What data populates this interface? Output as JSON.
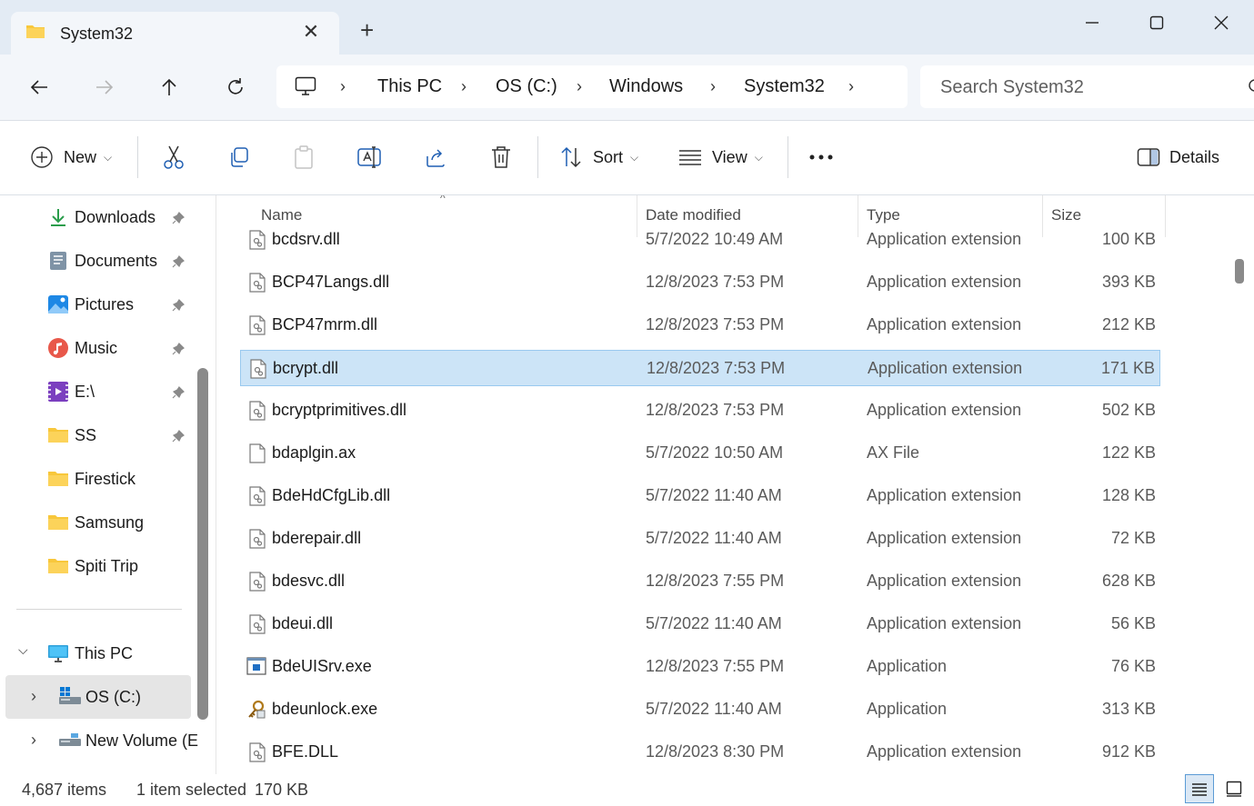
{
  "window": {
    "tab_title": "System32",
    "colors": {
      "accent": "#0067c0",
      "selection": "#cce4f7",
      "folder": "#f8c73b"
    }
  },
  "address": {
    "crumbs": [
      "This PC",
      "OS (C:)",
      "Windows",
      "System32"
    ]
  },
  "search": {
    "placeholder": "Search System32"
  },
  "toolbar": {
    "new_label": "New",
    "sort_label": "Sort",
    "view_label": "View",
    "details_label": "Details"
  },
  "nav": {
    "quick_access": [
      {
        "label": "Downloads",
        "icon": "download-icon",
        "pinned": true
      },
      {
        "label": "Documents",
        "icon": "documents-icon",
        "pinned": true
      },
      {
        "label": "Pictures",
        "icon": "pictures-icon",
        "pinned": true
      },
      {
        "label": "Music",
        "icon": "music-icon",
        "pinned": true
      },
      {
        "label": "E:\\",
        "icon": "video-icon",
        "pinned": true
      },
      {
        "label": "SS",
        "icon": "folder-icon",
        "pinned": true
      },
      {
        "label": "Firestick",
        "icon": "folder-icon",
        "pinned": false
      },
      {
        "label": "Samsung",
        "icon": "folder-icon",
        "pinned": false
      },
      {
        "label": "Spiti Trip",
        "icon": "folder-icon",
        "pinned": false
      }
    ],
    "this_pc": "This PC",
    "drives": [
      {
        "label": "OS (C:)",
        "selected": true
      },
      {
        "label": "New Volume (E",
        "selected": false
      }
    ]
  },
  "columns": {
    "name": "Name",
    "date": "Date modified",
    "type": "Type",
    "size": "Size"
  },
  "files": [
    {
      "name": "bcdsrv.dll",
      "date": "5/7/2022 10:49 AM",
      "type": "Application extension",
      "size": "100 KB",
      "icon": "dll",
      "selected": false
    },
    {
      "name": "BCP47Langs.dll",
      "date": "12/8/2023 7:53 PM",
      "type": "Application extension",
      "size": "393 KB",
      "icon": "dll",
      "selected": false
    },
    {
      "name": "BCP47mrm.dll",
      "date": "12/8/2023 7:53 PM",
      "type": "Application extension",
      "size": "212 KB",
      "icon": "dll",
      "selected": false
    },
    {
      "name": "bcrypt.dll",
      "date": "12/8/2023 7:53 PM",
      "type": "Application extension",
      "size": "171 KB",
      "icon": "dll",
      "selected": true
    },
    {
      "name": "bcryptprimitives.dll",
      "date": "12/8/2023 7:53 PM",
      "type": "Application extension",
      "size": "502 KB",
      "icon": "dll",
      "selected": false
    },
    {
      "name": "bdaplgin.ax",
      "date": "5/7/2022 10:50 AM",
      "type": "AX File",
      "size": "122 KB",
      "icon": "file",
      "selected": false
    },
    {
      "name": "BdeHdCfgLib.dll",
      "date": "5/7/2022 11:40 AM",
      "type": "Application extension",
      "size": "128 KB",
      "icon": "dll",
      "selected": false
    },
    {
      "name": "bderepair.dll",
      "date": "5/7/2022 11:40 AM",
      "type": "Application extension",
      "size": "72 KB",
      "icon": "dll",
      "selected": false
    },
    {
      "name": "bdesvc.dll",
      "date": "12/8/2023 7:55 PM",
      "type": "Application extension",
      "size": "628 KB",
      "icon": "dll",
      "selected": false
    },
    {
      "name": "bdeui.dll",
      "date": "5/7/2022 11:40 AM",
      "type": "Application extension",
      "size": "56 KB",
      "icon": "dll",
      "selected": false
    },
    {
      "name": "BdeUISrv.exe",
      "date": "12/8/2023 7:55 PM",
      "type": "Application",
      "size": "76 KB",
      "icon": "exe",
      "selected": false
    },
    {
      "name": "bdeunlock.exe",
      "date": "5/7/2022 11:40 AM",
      "type": "Application",
      "size": "313 KB",
      "icon": "key-exe",
      "selected": false
    },
    {
      "name": "BFE.DLL",
      "date": "12/8/2023 8:30 PM",
      "type": "Application extension",
      "size": "912 KB",
      "icon": "dll",
      "selected": false
    }
  ],
  "status": {
    "item_count": "4,687 items",
    "selection": "1 item selected",
    "selection_size": "170 KB"
  }
}
